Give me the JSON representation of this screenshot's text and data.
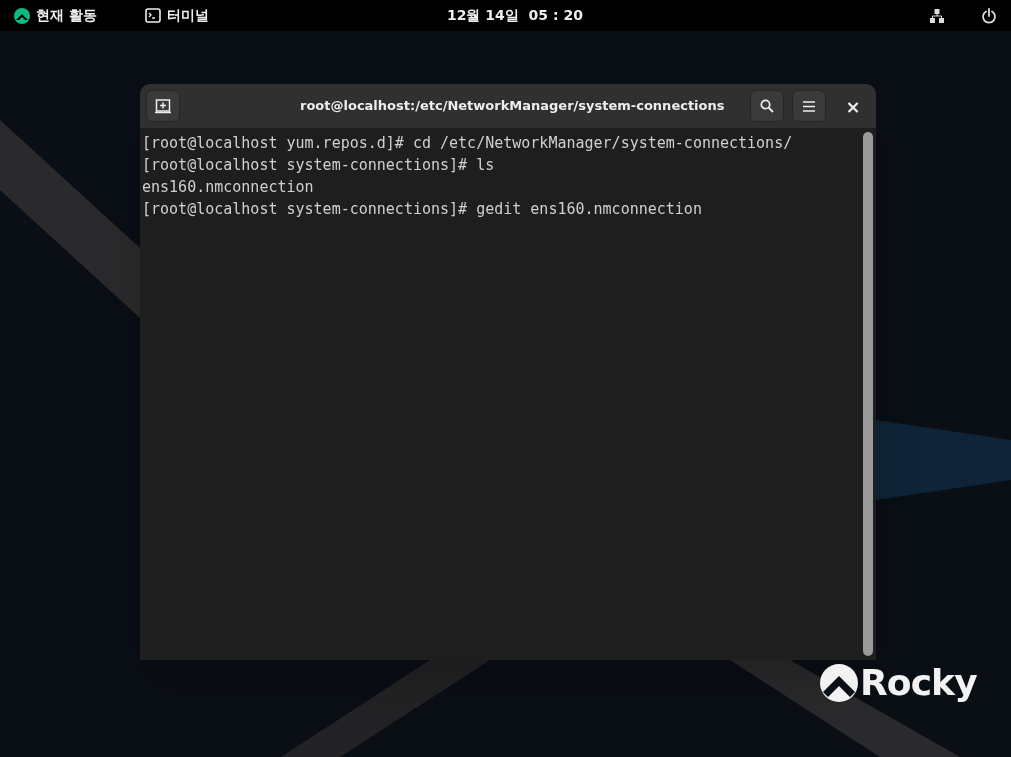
{
  "top_bar": {
    "activities": "현재 활동",
    "app": "터미널",
    "clock": "12월 14일  05 : 20"
  },
  "window": {
    "title": "root@localhost:/etc/NetworkManager/system-connections",
    "close": "×"
  },
  "terminal_lines": [
    "[root@localhost yum.repos.d]# cd /etc/NetworkManager/system-connections/",
    "[root@localhost system-connections]# ls",
    "ens160.nmconnection",
    "[root@localhost system-connections]# gedit ens160.nmconnection"
  ],
  "wallpaper_logo": "Rocky"
}
